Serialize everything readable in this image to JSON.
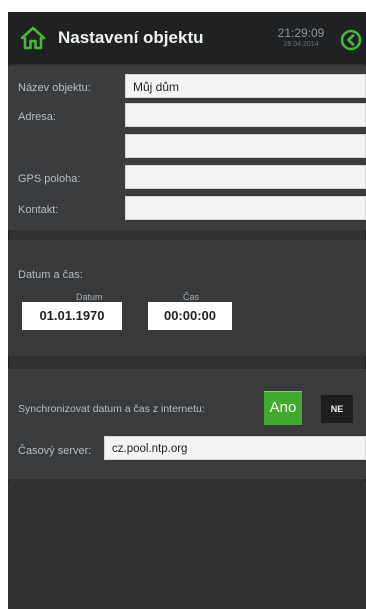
{
  "header": {
    "title": "Nastavení objektu",
    "time": "21:29:09",
    "date": "28.04.2014",
    "icons": {
      "home": "home-icon",
      "back": "back-circle-icon"
    },
    "accent_color": "#46b834"
  },
  "object": {
    "name_label": "Název objektu:",
    "name_value": "Můj dům",
    "address_label": "Adresa:",
    "address_line1": "",
    "address_line2": "",
    "gps_label": "GPS poloha:",
    "gps_value": "",
    "contact_label": "Kontakt:",
    "contact_value": ""
  },
  "datetime": {
    "section_label": "Datum a čas:",
    "date_label": "Datum",
    "date_value": "01.01.1970",
    "time_label": "Čas",
    "time_value": "00:00:00"
  },
  "sync": {
    "label": "Synchronizovat datum a čas z internetu:",
    "yes_label": "Ano",
    "no_label": "NE",
    "server_label": "Časový server:",
    "server_value": "cz.pool.ntp.org",
    "yes_color": "#3faa2b"
  }
}
